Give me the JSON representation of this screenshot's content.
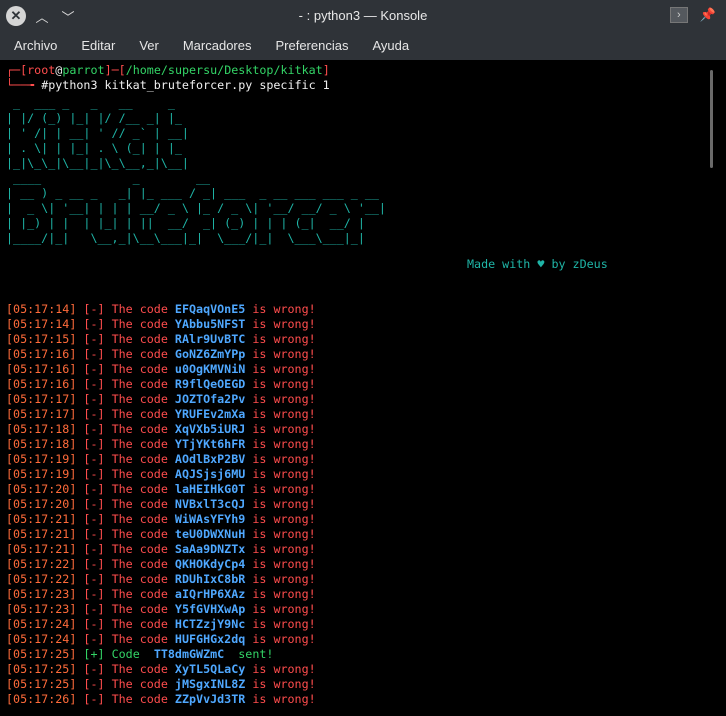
{
  "window": {
    "title": "- : python3 — Konsole"
  },
  "menu": [
    "Archivo",
    "Editar",
    "Ver",
    "Marcadores",
    "Preferencias",
    "Ayuda"
  ],
  "prompt": {
    "user": "root",
    "at": "@",
    "host": "parrot",
    "path": "/home/supersu/Desktop/kitkat",
    "command": "#python3 kitkat_bruteforcer.py specific 1"
  },
  "banner": {
    "ascii": " _  ___ _   _   __     _\n| |/ (_) |_| |/ /__ _| |_\n| ' /| | __| ' // _` | __|\n| . \\| | |_| . \\ (_| | |_\n|_|\\_\\_|\\__|_|\\_\\__,_|\\__|\n ____             _        __\n| __ ) _ __ _   _| |_ ___ / _| ___  _ __ ___ ___ _ __\n|  _ \\| '__| | | | __/ _ \\ |_ / _ \\| '__/ __/ _ \\ '__|\n| |_) | |  | |_| | ||  __/  _| (_) | | | (_|  __/ |\n|____/|_|   \\__,_|\\__\\___|_|  \\___/|_|  \\___\\___|_|",
    "made_with": "Made with ♥ by zDeus"
  },
  "log_text": {
    "fail_prefix": "[-]",
    "fail_mid": " The code ",
    "fail_suffix": " is wrong!",
    "ok_prefix": "[+]",
    "ok_mid": " Code  ",
    "ok_suffix": "  sent!"
  },
  "logs": [
    {
      "time": "[05:17:14]",
      "code": "EFQaqVOnE5",
      "ok": false
    },
    {
      "time": "[05:17:14]",
      "code": "YAbbu5NFST",
      "ok": false
    },
    {
      "time": "[05:17:15]",
      "code": "RAlr9UvBTC",
      "ok": false
    },
    {
      "time": "[05:17:16]",
      "code": "GoNZ6ZmYPp",
      "ok": false
    },
    {
      "time": "[05:17:16]",
      "code": "u0OgKMVNiN",
      "ok": false
    },
    {
      "time": "[05:17:16]",
      "code": "R9flQeOEGD",
      "ok": false
    },
    {
      "time": "[05:17:17]",
      "code": "JOZTOfa2Pv",
      "ok": false
    },
    {
      "time": "[05:17:17]",
      "code": "YRUFEv2mXa",
      "ok": false
    },
    {
      "time": "[05:17:18]",
      "code": "XqVXb5iURJ",
      "ok": false
    },
    {
      "time": "[05:17:18]",
      "code": "YTjYKt6hFR",
      "ok": false
    },
    {
      "time": "[05:17:19]",
      "code": "AOdlBxP2BV",
      "ok": false
    },
    {
      "time": "[05:17:19]",
      "code": "AQJSjsj6MU",
      "ok": false
    },
    {
      "time": "[05:17:20]",
      "code": "laHEIHkG0T",
      "ok": false
    },
    {
      "time": "[05:17:20]",
      "code": "NVBxlT3cQJ",
      "ok": false
    },
    {
      "time": "[05:17:21]",
      "code": "WiWAsYFYh9",
      "ok": false
    },
    {
      "time": "[05:17:21]",
      "code": "teU0DWXNuH",
      "ok": false
    },
    {
      "time": "[05:17:21]",
      "code": "SaAa9DNZTx",
      "ok": false
    },
    {
      "time": "[05:17:22]",
      "code": "QKHOKdyCp4",
      "ok": false
    },
    {
      "time": "[05:17:22]",
      "code": "RDUhIxC8bR",
      "ok": false
    },
    {
      "time": "[05:17:23]",
      "code": "aIQrHP6XAz",
      "ok": false
    },
    {
      "time": "[05:17:23]",
      "code": "Y5fGVHXwAp",
      "ok": false
    },
    {
      "time": "[05:17:24]",
      "code": "HCTZzjY9Nc",
      "ok": false
    },
    {
      "time": "[05:17:24]",
      "code": "HUFGHGx2dq",
      "ok": false
    },
    {
      "time": "[05:17:25]",
      "code": "TT8dmGWZmC",
      "ok": true
    },
    {
      "time": "[05:17:25]",
      "code": "XyTL5QLaCy",
      "ok": false
    },
    {
      "time": "[05:17:25]",
      "code": "jMSgxINL8Z",
      "ok": false
    },
    {
      "time": "[05:17:26]",
      "code": "ZZpVvJd3TR",
      "ok": false
    }
  ]
}
